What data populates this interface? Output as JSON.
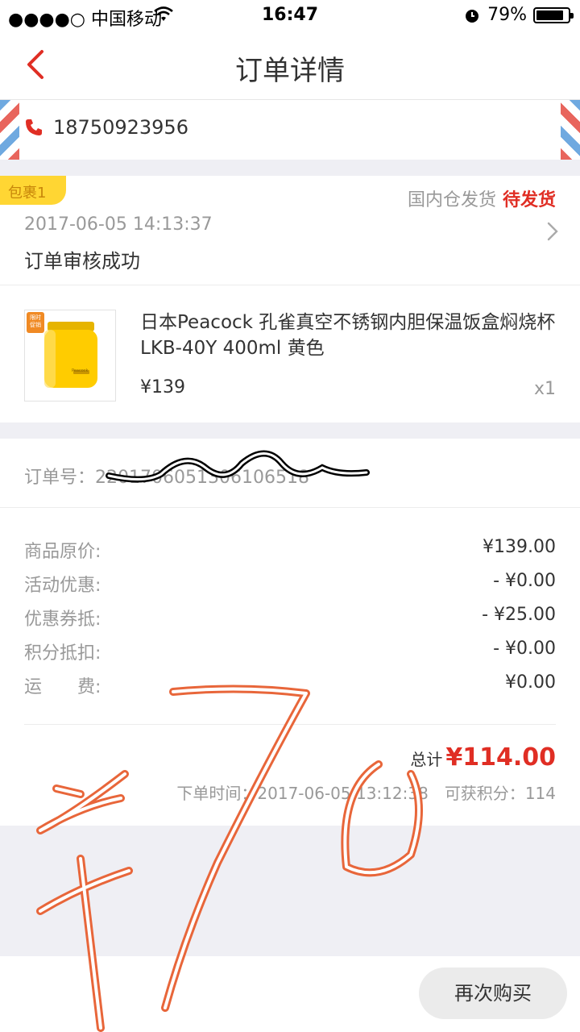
{
  "status_bar": {
    "carrier": "●●●●○ 中国移动",
    "time": "16:47",
    "battery": "79%"
  },
  "nav": {
    "title": "订单详情"
  },
  "address": {
    "phone": "18750923956"
  },
  "package": {
    "badge": "包裹1",
    "warehouse": "国内仓发货",
    "status": "待发货",
    "time": "2017-06-05 14:13:37",
    "message": "订单审核成功"
  },
  "product": {
    "name": "日本Peacock 孔雀真空不锈钢内胆保温饭盒焖烧杯LKB-40Y 400ml 黄色",
    "price": "¥139",
    "qty": "x1",
    "tag": "限时促销",
    "brand": "Peacock"
  },
  "order": {
    "number_label": "订单号：",
    "number": "2201706051306106518"
  },
  "prices": {
    "rows": [
      {
        "label": "商品原价:",
        "value": "¥139.00"
      },
      {
        "label": "活动优惠:",
        "value": "- ¥0.00"
      },
      {
        "label": "优惠券抵:",
        "value": "- ¥25.00"
      },
      {
        "label": "积分抵扣:",
        "value": "- ¥0.00"
      },
      {
        "label": "运　　费:",
        "value": "¥0.00"
      }
    ],
    "total_label": "总计",
    "total": "¥114.00",
    "order_time_label": "下单时间：",
    "order_time": "2017-06-05 13:12:38",
    "points_label": "可获积分：",
    "points": "114"
  },
  "bottom": {
    "rebuy": "再次购买"
  },
  "colors": {
    "accent": "#e02e24",
    "badge": "#ffd633",
    "scribble": "#e8663a"
  }
}
